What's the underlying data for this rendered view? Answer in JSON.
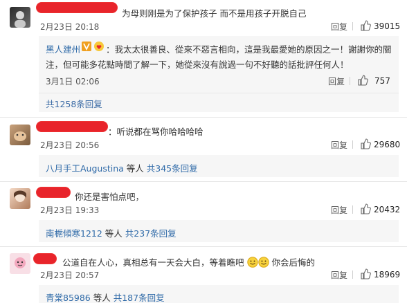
{
  "comments": [
    {
      "text": "为母则刚是为了保护孩子 而不是用孩子开脱自己",
      "date": "2月23日 20:18",
      "reply_label": "回复",
      "likes": "39015",
      "subreply": {
        "author": "黑人建州",
        "text_line1": "：我太太很善良、從來不惡言相向，這是我最愛她的原因之一！謝謝你的關",
        "text_line2": "注，但可能多花點時間了解一下，她從來沒有說過一句不好聽的話批評任何人！",
        "date": "3月1日 02:06",
        "reply_label": "回复",
        "likes": "757"
      },
      "total_replies": "共1258条回复"
    },
    {
      "text": "：听说都在骂你哈哈哈哈",
      "date": "2月23日 20:56",
      "reply_label": "回复",
      "likes": "29680",
      "reply_summary": {
        "name": "八月手工Augustina",
        "suffix": " 等人 ",
        "count": "共345条回复"
      }
    },
    {
      "text": "你还是害怕点吧，",
      "date": "2月23日 19:33",
      "reply_label": "回复",
      "likes": "20432",
      "reply_summary": {
        "name": "南梔傾寒1212",
        "suffix": " 等人 ",
        "count": "共237条回复"
      }
    },
    {
      "text_before": "公道自在人心，真相总有一天会大白，等着瞧吧",
      "text_after": "你会后悔的",
      "date": "2月23日 20:57",
      "reply_label": "回复",
      "likes": "18969",
      "reply_summary": {
        "name": "青棠85986",
        "suffix": " 等人 ",
        "count": "共187条回复"
      }
    }
  ],
  "colors": {
    "redaction": "#e8242b",
    "link": "#2f6aa8",
    "badge_v": "#f0a020"
  },
  "icons": [
    "thumbs-up-icon",
    "verified-v-icon",
    "heart-badge-icon",
    "smile-emoji-icon"
  ]
}
